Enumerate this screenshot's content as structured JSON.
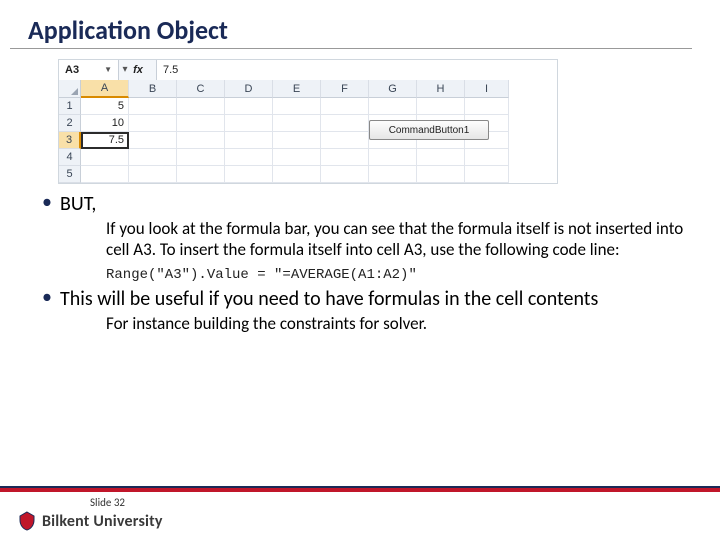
{
  "title": "Application Object",
  "excel": {
    "namebox": "A3",
    "fx_label": "fx",
    "formula_value": "7.5",
    "col_headers": [
      "A",
      "B",
      "C",
      "D",
      "E",
      "F",
      "G",
      "H",
      "I"
    ],
    "row_headers": [
      "1",
      "2",
      "3",
      "4",
      "5"
    ],
    "cells": {
      "A1": "5",
      "A2": "10",
      "A3": "7.5"
    },
    "button_label": "CommandButton1",
    "selected_col": "A",
    "selected_row": "3"
  },
  "bullets": [
    {
      "text": "BUT,",
      "subtext": "If you look at the formula bar, you can see that the formula itself is not inserted into cell A3. To insert the formula itself into cell A3, use the following code line:",
      "code": "Range(\"A3\").Value = \"=AVERAGE(A1:A2)\""
    },
    {
      "text": "This will be useful if you need to have formulas in the cell contents",
      "subtext": "For instance building the constraints for solver."
    }
  ],
  "footer": {
    "slide_label": "Slide 32",
    "university": "Bilkent University"
  }
}
